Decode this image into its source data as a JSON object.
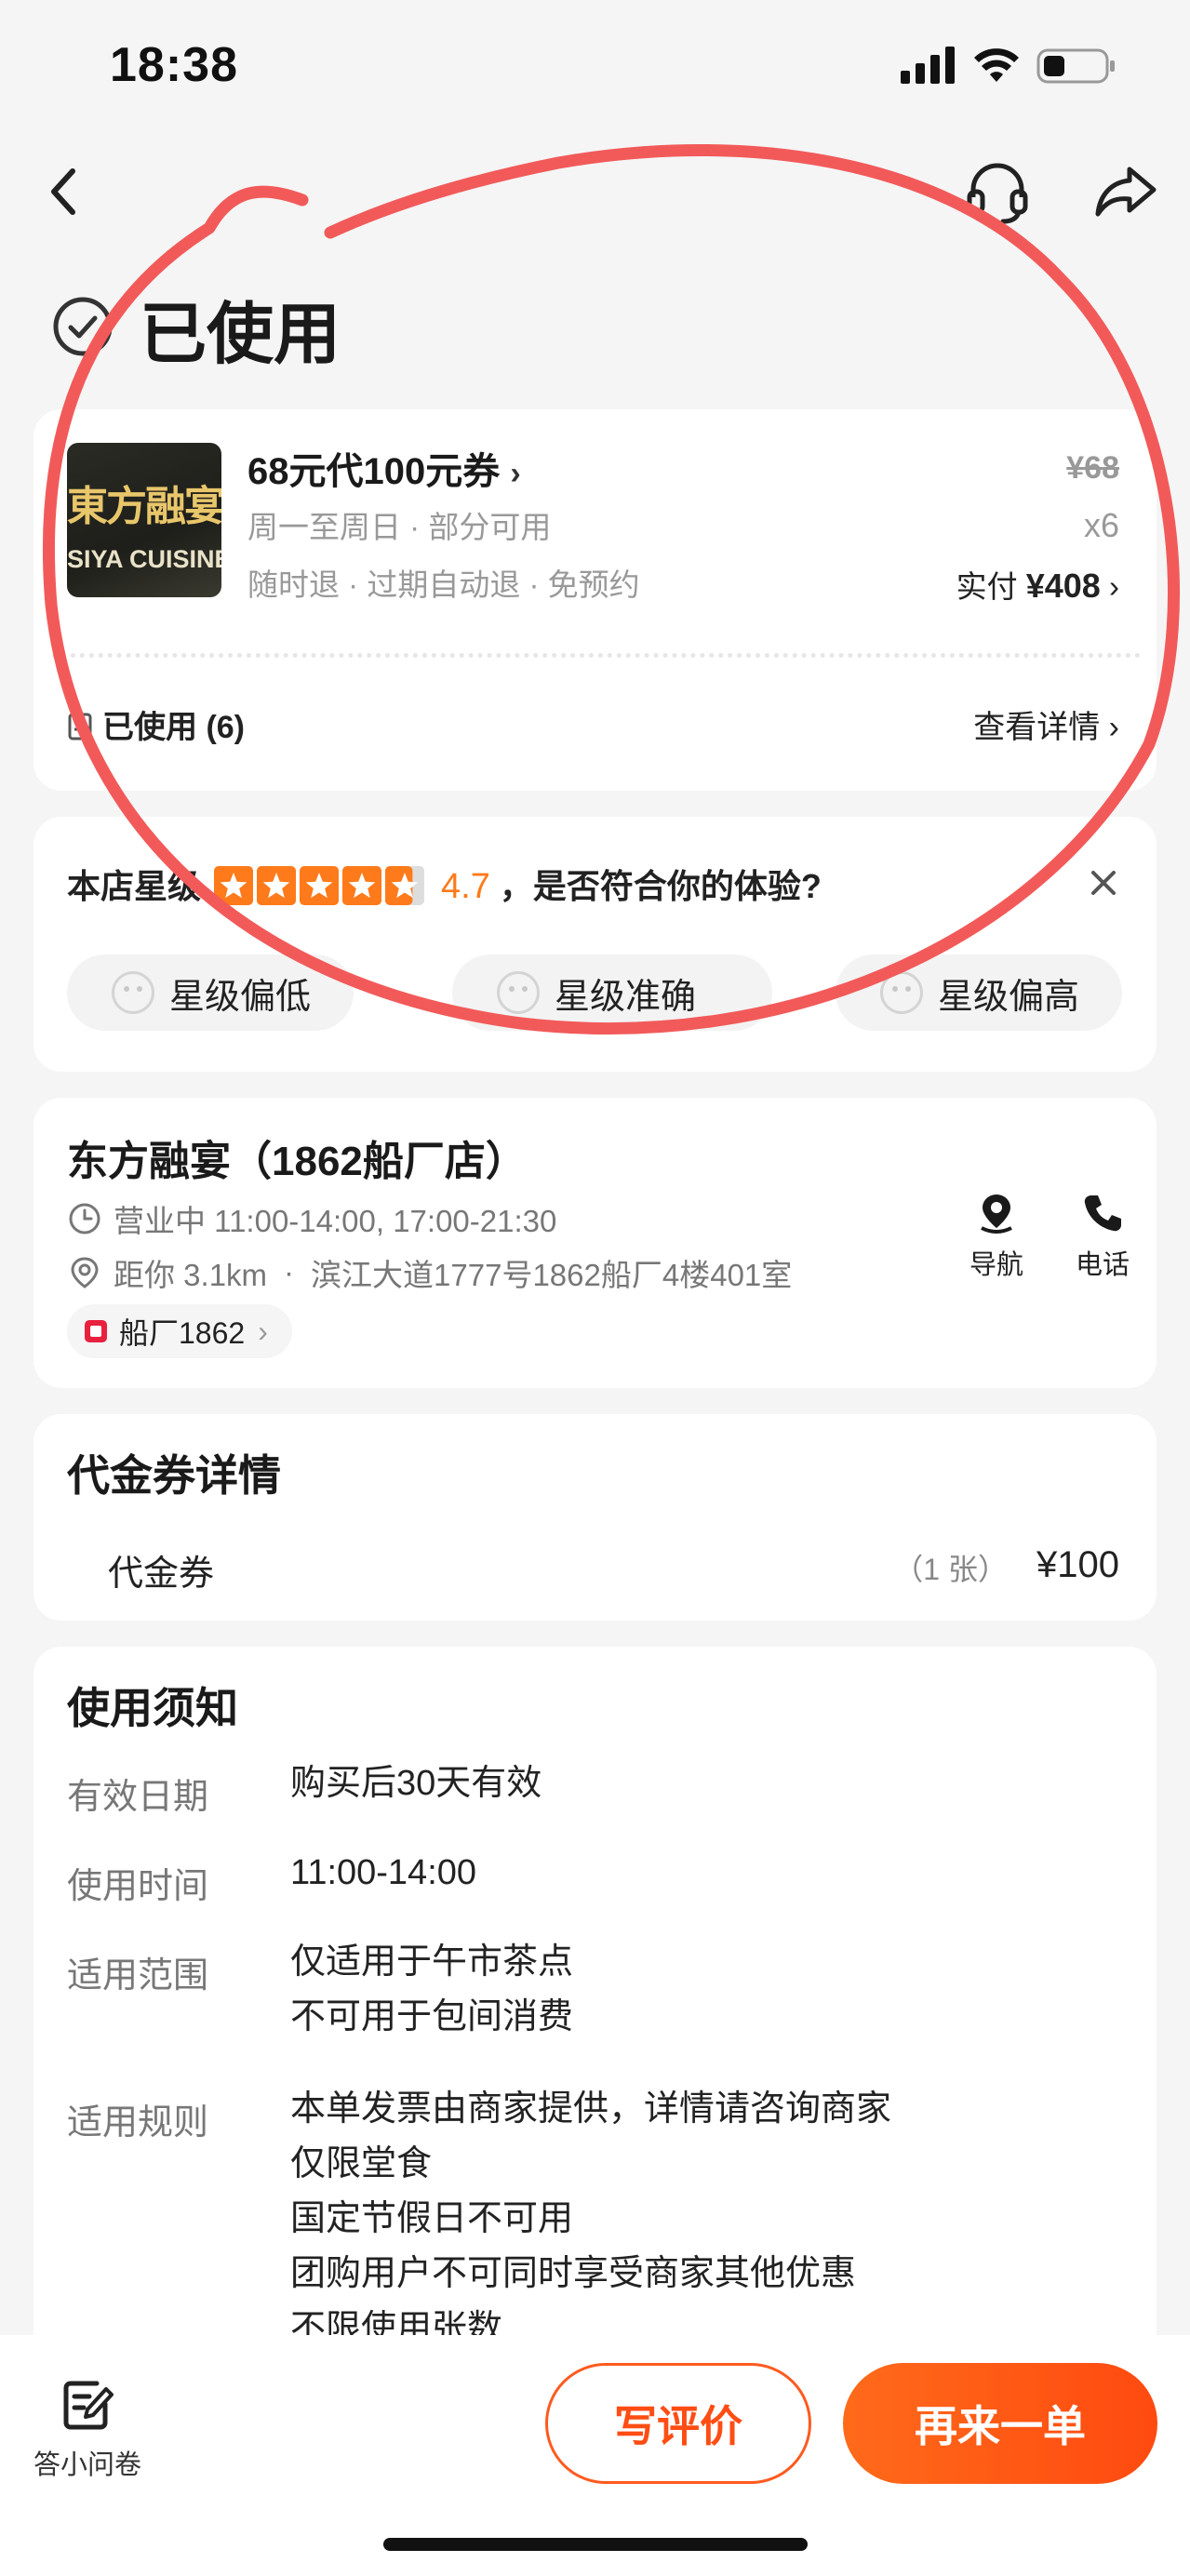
{
  "status_bar": {
    "time": "18:38"
  },
  "order_status": "已使用",
  "deal": {
    "thumb_cn": "東方融宴",
    "thumb_en": "SIYA CUISINE",
    "name": "68元代100元券",
    "line1": "周一至周日 · 部分可用",
    "line2": "随时退 · 过期自动退 · 免预约",
    "price": "¥68",
    "quantity": "x6",
    "paid_label": "实付",
    "paid_amount": "¥408",
    "used": "已使用 (6)",
    "detail_link": "查看详情"
  },
  "rating": {
    "prefix": "本店星级",
    "score": "4.7",
    "stars": 4.7,
    "question": "，是否符合你的体验?",
    "options": [
      "星级偏低",
      "星级准确",
      "星级偏高"
    ]
  },
  "shop": {
    "name": "东方融宴（1862船厂店）",
    "hours": "营业中 11:00-14:00, 17:00-21:30",
    "distance": "距你 3.1km",
    "address": "滨江大道1777号1862船厂4楼401室",
    "mall": "船厂1862",
    "nav_label": "导航",
    "call_label": "电话"
  },
  "voucher": {
    "title": "代金券详情",
    "item": "代金券",
    "count": "（1 张）",
    "value": "¥100"
  },
  "notice": {
    "title": "使用须知",
    "rows": [
      {
        "label": "有效日期",
        "value": "购买后30天有效"
      },
      {
        "label": "使用时间",
        "value": "11:00-14:00"
      },
      {
        "label": "适用范围",
        "value": "仅适用于午市茶点\n不可用于包间消费"
      },
      {
        "label": "适用规则",
        "value": "本单发票由商家提供，详情请咨询商家\n仅限堂食\n国定节假日不可用\n团购用户不可同时享受商家其他优惠\n不限使用张数"
      }
    ]
  },
  "bottom": {
    "survey": "答小问卷",
    "review": "写评价",
    "reorder": "再来一单"
  },
  "colors": {
    "accent": "#ff5a1f",
    "star": "#ff7a1a",
    "annotation": "#f25a5a"
  }
}
